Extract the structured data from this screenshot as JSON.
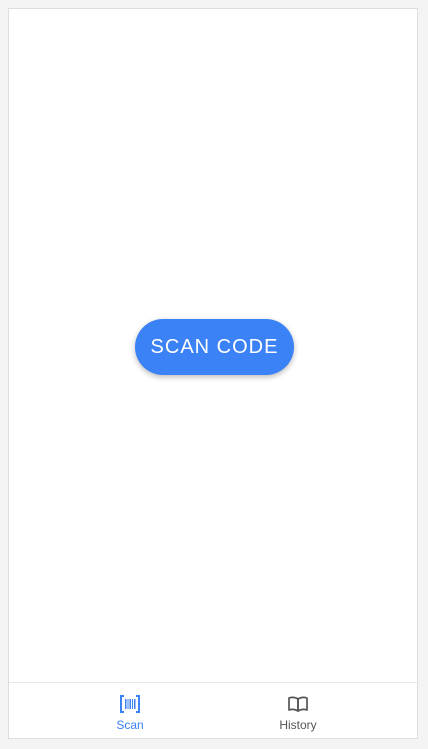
{
  "main": {
    "scan_button_label": "SCAN CODE"
  },
  "bottom_nav": {
    "items": [
      {
        "label": "Scan",
        "icon": "barcode-icon",
        "active": true
      },
      {
        "label": "History",
        "icon": "book-icon",
        "active": false
      }
    ]
  },
  "colors": {
    "accent": "#3b82f6",
    "inactive": "#555555"
  }
}
